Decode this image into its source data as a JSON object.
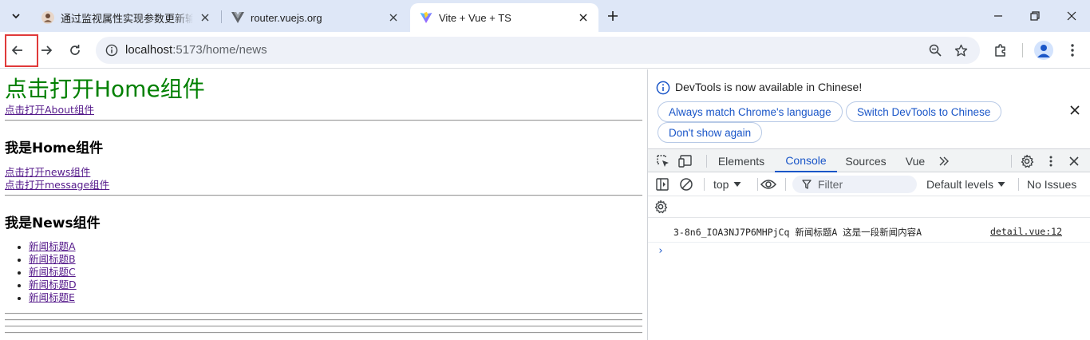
{
  "browser": {
    "tabs": [
      {
        "title": "通过监视属性实现参数更新输出",
        "active": false,
        "favicon": "person-avatar-icon"
      },
      {
        "title": "router.vuejs.org",
        "active": false,
        "favicon": "vue-logo-icon"
      },
      {
        "title": "Vite + Vue + TS",
        "active": true,
        "favicon": "vite-logo-icon"
      }
    ],
    "url_host": "localhost",
    "url_path": ":5173/home/news"
  },
  "page": {
    "home_link": "点击打开Home组件",
    "about_link": "点击打开About组件",
    "home_heading": "我是Home组件",
    "news_link": "点击打开news组件",
    "message_link": "点击打开message组件",
    "news_heading": "我是News组件",
    "news_items": [
      "新闻标题A",
      "新闻标题B",
      "新闻标题C",
      "新闻标题D",
      "新闻标题E"
    ]
  },
  "devtools": {
    "banner": {
      "text": "DevTools is now available in Chinese!",
      "btn_match": "Always match Chrome's language",
      "btn_switch": "Switch DevTools to Chinese",
      "btn_dismiss": "Don't show again"
    },
    "tabs": [
      "Elements",
      "Console",
      "Sources",
      "Vue"
    ],
    "active_tab": "Console",
    "context": "top",
    "filter_placeholder": "Filter",
    "levels": "Default levels",
    "issues": "No Issues",
    "log": {
      "message": "3-8n6_IOA3NJ7P6MHPjCq 新闻标题A 这是一段新闻内容A",
      "source": "detail.vue:12"
    },
    "prompt": "›"
  },
  "colors": {
    "accent": "#1a56c8",
    "highlight_box": "#e03a3a",
    "home_link": "#008000",
    "visited_link": "#551a8b"
  }
}
